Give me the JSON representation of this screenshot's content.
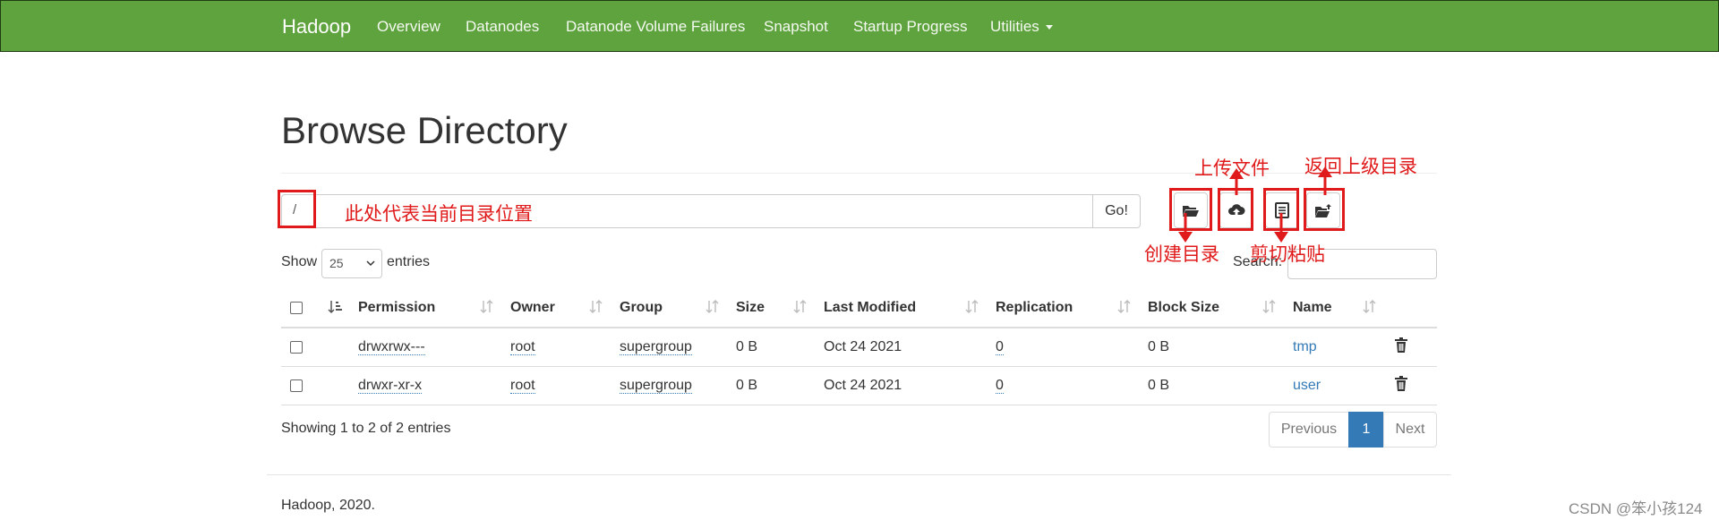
{
  "navbar": {
    "brand": "Hadoop",
    "items": [
      "Overview",
      "Datanodes",
      "Datanode Volume Failures",
      "Snapshot",
      "Startup Progress",
      "Utilities"
    ]
  },
  "page_title": "Browse Directory",
  "path_input": {
    "value": "/"
  },
  "go_label": "Go!",
  "annotations": {
    "current_dir": "此处代表当前目录位置",
    "upload": "上传文件",
    "parent_dir": "返回上级目录",
    "create_dir": "创建目录",
    "cut_paste": "剪切粘贴"
  },
  "show_label": "Show",
  "page_size": "25",
  "entries_label": "entries",
  "search_label": "Search:",
  "columns": [
    "Permission",
    "Owner",
    "Group",
    "Size",
    "Last Modified",
    "Replication",
    "Block Size",
    "Name"
  ],
  "rows": [
    {
      "permission": "drwxrwx---",
      "owner": "root",
      "group": "supergroup",
      "size": "0 B",
      "last_modified": "Oct 24 2021",
      "replication": "0",
      "block_size": "0 B",
      "name": "tmp"
    },
    {
      "permission": "drwxr-xr-x",
      "owner": "root",
      "group": "supergroup",
      "size": "0 B",
      "last_modified": "Oct 24 2021",
      "replication": "0",
      "block_size": "0 B",
      "name": "user"
    }
  ],
  "info_text": "Showing 1 to 2 of 2 entries",
  "pagination": {
    "previous": "Previous",
    "current": "1",
    "next": "Next"
  },
  "footer": "Hadoop, 2020.",
  "watermark": "CSDN @笨小孩124",
  "colors": {
    "navbar": "#5fa33e",
    "link": "#337ab7",
    "annotation": "#e01a1a",
    "active_page": "#337ab7"
  },
  "icons": [
    "folder-open-icon",
    "upload-cloud-icon",
    "list-icon",
    "folder-up-icon",
    "trash-icon",
    "sort-icon"
  ]
}
